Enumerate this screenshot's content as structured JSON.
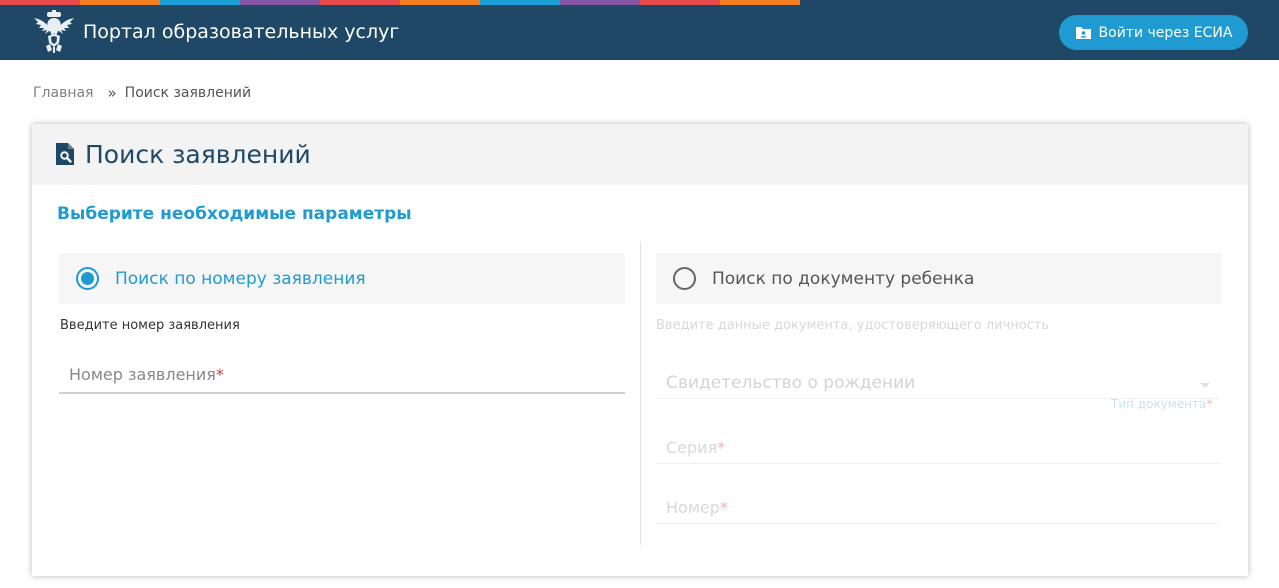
{
  "header": {
    "title": "Портал образовательных услуг",
    "login_label": "Войти через ЕСИА",
    "strip_colors": [
      "#e54b4b",
      "#f37d21",
      "#1aa0d6",
      "#8755a8",
      "#e54b4b",
      "#f37d21",
      "#1aa0d6",
      "#8755a8",
      "#e54b4b",
      "#f37d21"
    ],
    "background_color": "#1e4866",
    "accent_color": "#1f9bd1"
  },
  "breadcrumb": {
    "home": "Главная",
    "separator": "»",
    "current": "Поиск заявлений"
  },
  "card": {
    "title": "Поиск заявлений",
    "section_title": "Выберите необходимые параметры",
    "option_by_number": {
      "label": "Поиск по номеру заявления",
      "checked": true,
      "hint": "Введите номер заявления",
      "field_placeholder": "Номер заявления",
      "required_mark": "*"
    },
    "option_by_document": {
      "label": "Поиск по документу ребенка",
      "checked": false,
      "hint": "Введите данные документа, удостоверяющего личность",
      "doc_type_value": "Свидетельство о рождении",
      "doc_type_label": "Тип документа",
      "series_placeholder": "Серия",
      "number_placeholder": "Номер",
      "required_mark": "*"
    }
  }
}
